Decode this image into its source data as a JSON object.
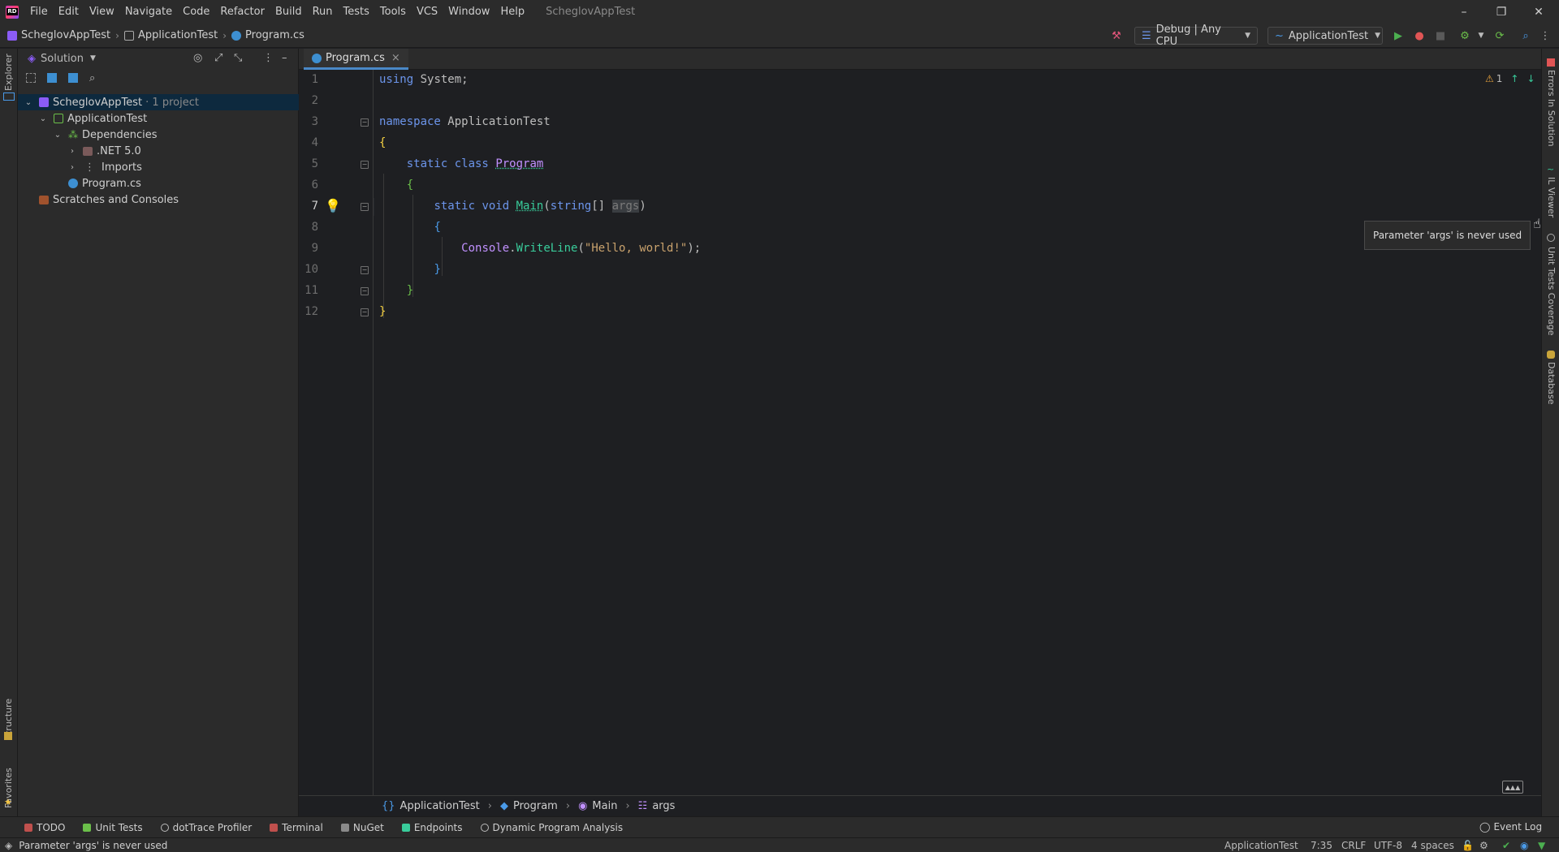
{
  "menubar": {
    "logo_text": "RD",
    "items": [
      "File",
      "Edit",
      "View",
      "Navigate",
      "Code",
      "Refactor",
      "Build",
      "Run",
      "Tests",
      "Tools",
      "VCS",
      "Window",
      "Help"
    ],
    "window_title": "ScheglovAppTest",
    "controls": {
      "minimize": "–",
      "restore": "❐",
      "close": "✕"
    }
  },
  "navbar": {
    "crumbs": [
      "ScheglovAppTest",
      "ApplicationTest",
      "Program.cs"
    ],
    "config_combo": "Debug | Any CPU",
    "run_target_combo": "ApplicationTest"
  },
  "explorer": {
    "title": "Solution",
    "tree": {
      "solution": "ScheglovAppTest",
      "solution_suffix": "· 1 project",
      "project": "ApplicationTest",
      "dependencies": "Dependencies",
      "net": ".NET 5.0",
      "imports": "Imports",
      "file": "Program.cs",
      "scratches": "Scratches and Consoles"
    }
  },
  "left_strip": {
    "top_label": "Explorer",
    "structure": "Structure",
    "favorites": "Favorites"
  },
  "right_strip": {
    "errors": "Errors In Solution",
    "il_viewer": "IL Viewer",
    "coverage": "Unit Tests Coverage",
    "database": "Database"
  },
  "editor": {
    "tab_label": "Program.cs",
    "tab_close": "×",
    "line_numbers": [
      "1",
      "2",
      "3",
      "4",
      "5",
      "6",
      "7",
      "8",
      "9",
      "10",
      "11",
      "12"
    ],
    "code": {
      "l1_kw": "using",
      "l1_rest": " System;",
      "l3_kw": "namespace",
      "l3_name": " ApplicationTest",
      "l4": "{",
      "l5_kw": "static class",
      "l5_name": "Program",
      "l6": "{",
      "l7_kw": "static void",
      "l7_method": "Main",
      "l7_paren": "(",
      "l7_type": "string",
      "l7_arr": "[] ",
      "l7_param": "args",
      "l7_close": ")",
      "l8": "{",
      "l9_obj": "Console",
      "l9_dot": ".",
      "l9_method": "WriteLine",
      "l9_open": "(",
      "l9_str": "\"Hello, world!\"",
      "l9_close": ");",
      "l10": "}",
      "l11": "}",
      "l12": "}"
    },
    "warning_count": "1",
    "tooltip": "Parameter 'args' is never used"
  },
  "breadcrumb_bar": {
    "items": [
      "ApplicationTest",
      "Program",
      "Main",
      "args"
    ]
  },
  "bottom_toolbar": {
    "items": [
      "TODO",
      "Unit Tests",
      "dotTrace Profiler",
      "Terminal",
      "NuGet",
      "Endpoints",
      "Dynamic Program Analysis"
    ],
    "event_log": "Event Log"
  },
  "statusbar": {
    "message": "Parameter 'args' is never used",
    "project": "ApplicationTest",
    "position": "7:35",
    "line_sep": "CRLF",
    "encoding": "UTF-8",
    "indent": "4 spaces"
  },
  "colors": {
    "accent": "#4a88c7",
    "keyword": "#6c95eb",
    "method": "#39cc9b",
    "string": "#c9a26d",
    "warning": "#e8a33d"
  }
}
